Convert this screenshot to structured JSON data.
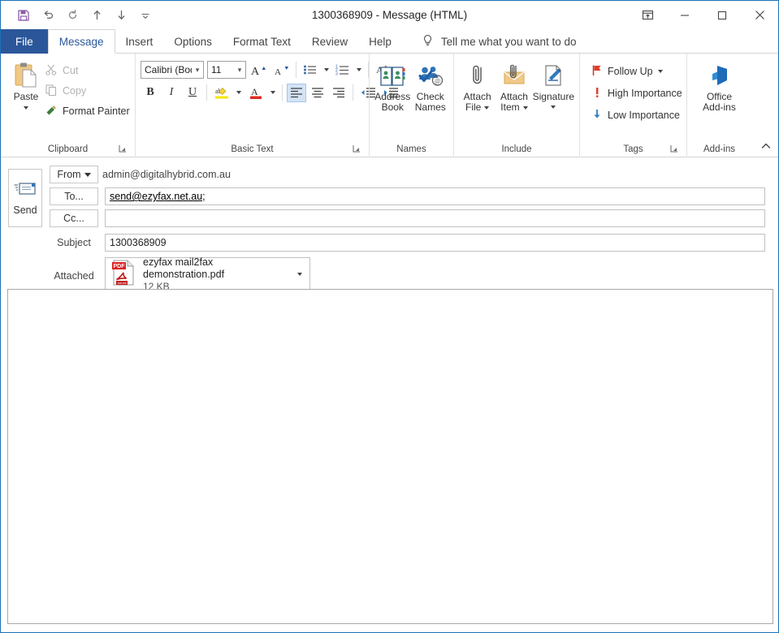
{
  "window": {
    "title": "1300368909  -  Message (HTML)",
    "accent_color": "#2b579a",
    "border_color": "#1b72b8"
  },
  "quick_access": {
    "items": [
      {
        "name": "save-icon",
        "label": "Save"
      },
      {
        "name": "undo-icon",
        "label": "Undo"
      },
      {
        "name": "redo-icon",
        "label": "Redo"
      },
      {
        "name": "previous-item-icon",
        "label": "Previous Item"
      },
      {
        "name": "next-item-icon",
        "label": "Next Item"
      },
      {
        "name": "customize-quick-access-toolbar-icon",
        "label": "Customize Quick Access Toolbar"
      }
    ]
  },
  "window_controls": {
    "ribbon_display_options": "Ribbon Display Options",
    "minimize": "Minimize",
    "maximize": "Maximize",
    "close": "Close"
  },
  "tabs": {
    "file": "File",
    "items": [
      {
        "label": "Message",
        "active": true
      },
      {
        "label": "Insert",
        "active": false
      },
      {
        "label": "Options",
        "active": false
      },
      {
        "label": "Format Text",
        "active": false
      },
      {
        "label": "Review",
        "active": false
      },
      {
        "label": "Help",
        "active": false
      }
    ],
    "tellme": "Tell me what you want to do"
  },
  "ribbon": {
    "clipboard": {
      "label": "Clipboard",
      "paste": "Paste",
      "cut": "Cut",
      "copy": "Copy",
      "format_painter": "Format Painter"
    },
    "basic_text": {
      "label": "Basic Text",
      "font_name": "Calibri (Bod",
      "font_size": "11",
      "grow_font": "Increase Font Size",
      "shrink_font": "Decrease Font Size",
      "bullets": "Bullets",
      "numbering": "Numbering",
      "clear_formatting": "Clear All Formatting",
      "bold": "B",
      "italic": "I",
      "underline": "U",
      "text_highlight": "Text Highlight Color",
      "font_color": "Font Color",
      "align_left": "Align Left",
      "align_center": "Center",
      "align_right": "Align Right",
      "decrease_indent": "Decrease Indent",
      "increase_indent": "Increase Indent"
    },
    "names": {
      "label": "Names",
      "address_book": "Address\nBook",
      "address_book_line1": "Address",
      "address_book_line2": "Book",
      "check_names_line1": "Check",
      "check_names_line2": "Names"
    },
    "include": {
      "label": "Include",
      "attach_file_line1": "Attach",
      "attach_file_line2": "File",
      "attach_item_line1": "Attach",
      "attach_item_line2": "Item",
      "signature": "Signature"
    },
    "tags": {
      "label": "Tags",
      "follow_up": "Follow Up",
      "high_importance": "High Importance",
      "low_importance": "Low Importance"
    },
    "addins": {
      "label": "Add-ins",
      "office_addins_line1": "Office",
      "office_addins_line2": "Add-ins"
    },
    "collapse": "Collapse the Ribbon"
  },
  "compose": {
    "send_label": "Send",
    "from_label": "From",
    "from_value": "admin@digitalhybrid.com.au",
    "to_label": "To...",
    "to_value": "send@ezyfax.net.au;",
    "cc_label": "Cc...",
    "cc_value": "",
    "subject_label": "Subject",
    "subject_value": "1300368909",
    "attached_label": "Attached",
    "attachment": {
      "name": "ezyfax mail2fax demonstration.pdf",
      "size": "12 KB",
      "type_badge": "PDF",
      "brand": "Adobe"
    },
    "body_value": ""
  }
}
